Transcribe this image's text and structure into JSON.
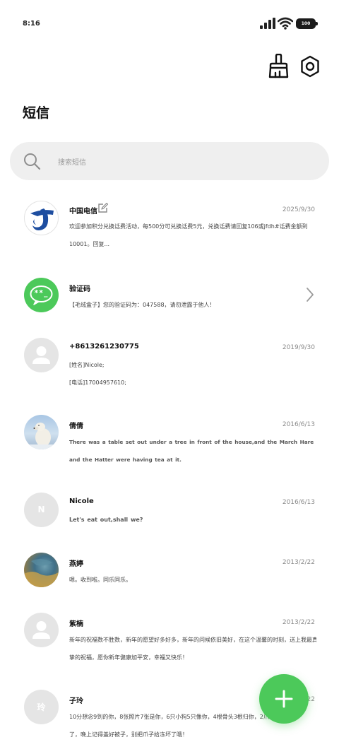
{
  "status_bar": {
    "time": "8:16",
    "battery": "100"
  },
  "header": {
    "title": "短信"
  },
  "search": {
    "placeholder": "搜索短信"
  },
  "icons": {
    "cleanup": "broom-icon",
    "settings": "settings-hexagon-icon",
    "search": "search-icon",
    "add": "plus-icon",
    "edit": "edit-icon",
    "chevron": "chevron-right-icon"
  },
  "colors": {
    "accent_green": "#4cc95a",
    "telecom_blue": "#1e4ea0",
    "avatar_gray": "#e5e5e5"
  },
  "messages": [
    {
      "sender": "中国电信",
      "date": "2025/9/30",
      "lines": [
        "欢迎参加积分兑换话费活动，每500分可兑换话费5元，兑换话费请回复106或jfdh#话费金额到",
        "10001。回复..."
      ]
    },
    {
      "sender": "验证码",
      "date": "",
      "avatar_text": "**_",
      "lines": [
        "【毛绒盒子】您的验证码为：047588，请勿泄露于他人！"
      ]
    },
    {
      "sender": "+8613261230775",
      "date": "2019/9/30",
      "lines": [
        "[姓名]Nicole;",
        "[电话]17004957610;"
      ]
    },
    {
      "sender": "倩倩",
      "date": "2016/6/13",
      "lines": [
        "There was a table set out under a tree in front of the house,and the March Hare",
        "and the Hatter were having tea at it."
      ]
    },
    {
      "sender": "Nicole",
      "date": "2016/6/13",
      "avatar_text": "N",
      "lines": [
        "Let's eat out,shall we?"
      ]
    },
    {
      "sender": "燕婷",
      "date": "2013/2/22",
      "lines": [
        "嗯。收到啦。同乐同乐。"
      ]
    },
    {
      "sender": "紫楠",
      "date": "2013/2/22",
      "lines": [
        "新年的祝福数不胜数，新年的愿望好多好多，新年的问候依旧美好，在这个温馨的时刻，送上我最真",
        "挚的祝福，愿你新年健康加平安，幸福又快乐！"
      ]
    },
    {
      "sender": "子玲",
      "date": "2013/2/22",
      "avatar_text": "玲",
      "lines": [
        "10分想念9到的你，8张照片7张是你，6只小狗5只像你，4根骨头3根归你，2爪着你1天冷",
        "了，晚上记得盖好被子，别把爪子给冻坏了哦！"
      ]
    }
  ]
}
